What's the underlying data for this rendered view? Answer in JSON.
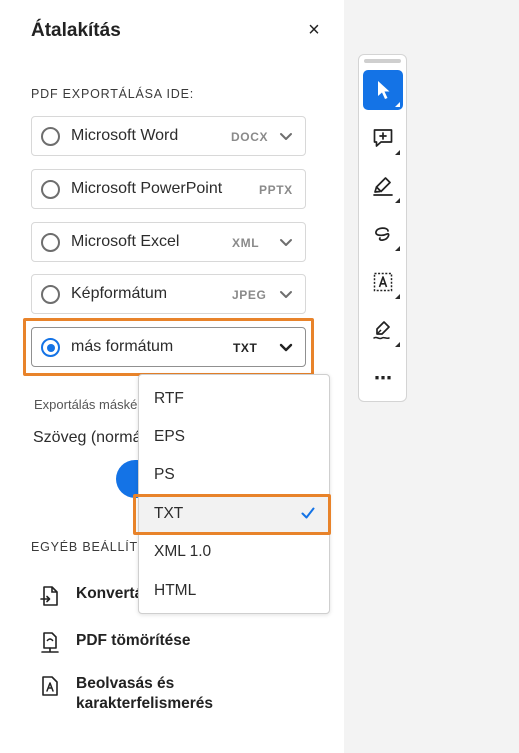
{
  "panel": {
    "title": "Átalakítás",
    "close_label": "×",
    "export_section_label": "PDF EXPORTÁLÁSA IDE:",
    "formats": [
      {
        "label": "Microsoft Word",
        "ext": "DOCX",
        "has_chevron": true,
        "selected": false
      },
      {
        "label": "Microsoft PowerPoint",
        "ext": "PPTX",
        "has_chevron": false,
        "selected": false
      },
      {
        "label": "Microsoft Excel",
        "ext": "XML",
        "has_chevron": true,
        "selected": false
      },
      {
        "label": "Képformátum",
        "ext": "JPEG",
        "has_chevron": true,
        "selected": false
      },
      {
        "label": "más formátum",
        "ext": "TXT",
        "has_chevron": true,
        "selected": true
      }
    ],
    "export_note": "Exportálás máské",
    "text_mode": "Szöveg (normá",
    "other_section_label": "EGYÉB BEÁLLÍTÁS",
    "tools": [
      {
        "label": "Konvertá",
        "icon": "convert-pdf-icon"
      },
      {
        "label": "PDF tömörítése",
        "icon": "compress-pdf-icon"
      },
      {
        "label": "Beolvasás és\nkarakterfelismerés",
        "label_line1": "Beolvasás és",
        "label_line2": "karakterfelismerés",
        "icon": "scan-ocr-icon"
      }
    ]
  },
  "dropdown": {
    "options": [
      "RTF",
      "EPS",
      "PS",
      "TXT",
      "XML 1.0",
      "HTML"
    ],
    "selected": "TXT"
  },
  "toolbar": {
    "tools": [
      "select-cursor-icon",
      "add-comment-icon",
      "highlight-pen-icon",
      "draw-freehand-icon",
      "text-box-icon",
      "sign-icon",
      "more-icon"
    ],
    "more_label": "⋯"
  },
  "colors": {
    "accent": "#1473e6",
    "highlight": "#e8832a",
    "sidebar_bg": "#f3f3f3"
  }
}
